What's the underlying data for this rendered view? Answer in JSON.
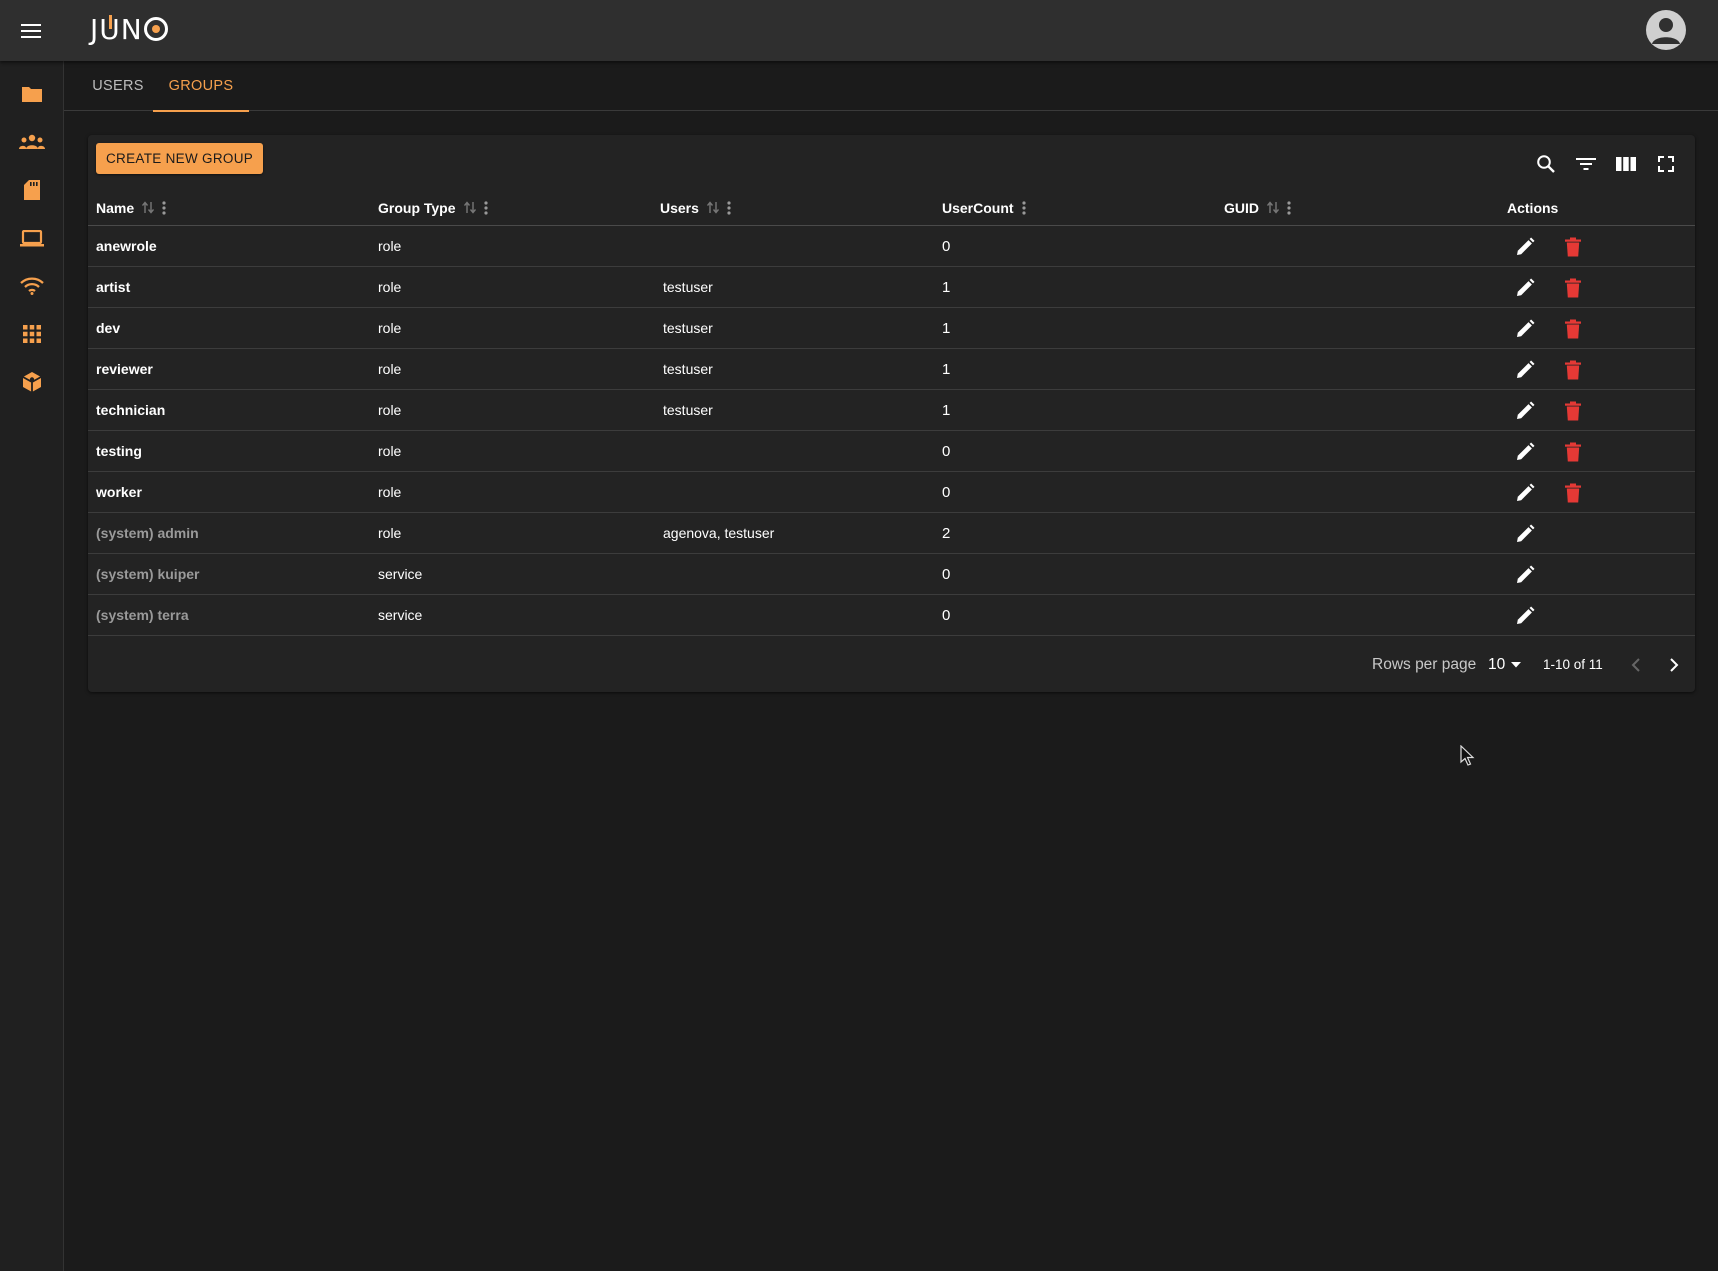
{
  "app": {
    "logo_text": "JUNO"
  },
  "tabs": [
    {
      "label": "USERS",
      "active": false
    },
    {
      "label": "GROUPS",
      "active": true
    }
  ],
  "toolbar": {
    "create_label": "CREATE NEW GROUP"
  },
  "table": {
    "columns": [
      {
        "label": "Name",
        "sortable": true
      },
      {
        "label": "Group Type",
        "sortable": true
      },
      {
        "label": "Users",
        "sortable": true
      },
      {
        "label": "UserCount",
        "sortable": false
      },
      {
        "label": "GUID",
        "sortable": true
      },
      {
        "label": "Actions",
        "sortable": false
      }
    ],
    "rows": [
      {
        "name": "anewrole",
        "type": "role",
        "users": "",
        "count": "0",
        "guid": "",
        "system": false
      },
      {
        "name": "artist",
        "type": "role",
        "users": "testuser",
        "count": "1",
        "guid": "",
        "system": false
      },
      {
        "name": "dev",
        "type": "role",
        "users": "testuser",
        "count": "1",
        "guid": "",
        "system": false
      },
      {
        "name": "reviewer",
        "type": "role",
        "users": "testuser",
        "count": "1",
        "guid": "",
        "system": false
      },
      {
        "name": "technician",
        "type": "role",
        "users": "testuser",
        "count": "1",
        "guid": "",
        "system": false
      },
      {
        "name": "testing",
        "type": "role",
        "users": "",
        "count": "0",
        "guid": "",
        "system": false
      },
      {
        "name": "worker",
        "type": "role",
        "users": "",
        "count": "0",
        "guid": "",
        "system": false
      },
      {
        "name": "(system) admin",
        "type": "role",
        "users": "agenova, testuser",
        "count": "2",
        "guid": "",
        "system": true
      },
      {
        "name": "(system) kuiper",
        "type": "service",
        "users": "",
        "count": "0",
        "guid": "",
        "system": true
      },
      {
        "name": "(system) terra",
        "type": "service",
        "users": "",
        "count": "0",
        "guid": "",
        "system": true
      }
    ]
  },
  "pagination": {
    "rows_per_page_label": "Rows per page",
    "rows_per_page_value": "10",
    "range_text": "1-10 of 11"
  },
  "colors": {
    "accent": "#f6a04d",
    "delete": "#e53935",
    "background": "#1b1b1b",
    "card": "#232323",
    "topbar": "#2f2f2f"
  },
  "icons": {
    "sidebar": [
      "folder-icon",
      "groups-icon",
      "sd-card-icon",
      "laptop-icon",
      "wifi-icon",
      "apps-grid-icon",
      "package-icon"
    ],
    "row_actions": [
      "edit-icon",
      "delete-icon"
    ]
  }
}
